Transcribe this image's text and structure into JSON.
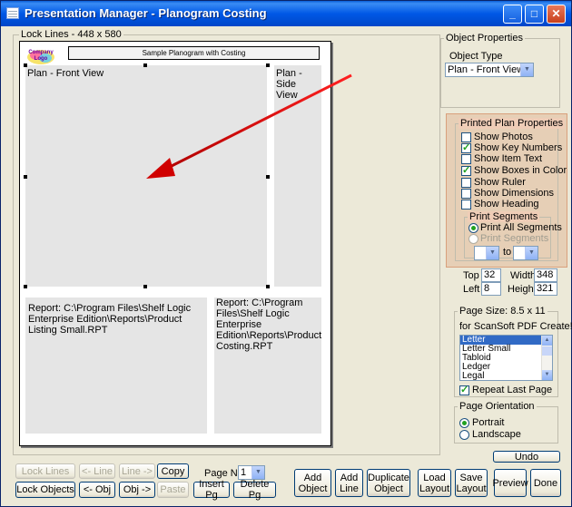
{
  "window": {
    "title": "Presentation Manager - Planogram Costing"
  },
  "canvas": {
    "legend": "Lock Lines - 448 x 580",
    "page": {
      "logo_text": "Company\nLogo",
      "banner": "Sample Planogram with Costing",
      "front_view_label": "Plan - Front View",
      "side_view_label": "Plan - Side View",
      "report1": "Report: C:\\Program Files\\Shelf Logic Enterprise Edition\\Reports\\Product Listing Small.RPT",
      "report2": "Report: C:\\Program Files\\Shelf Logic Enterprise Edition\\Reports\\Product Costing.RPT"
    }
  },
  "object_properties": {
    "legend": "Object Properties",
    "type_label": "Object Type",
    "type_value": "Plan - Front View"
  },
  "printed_plan_properties": {
    "legend": "Printed Plan Properties",
    "options": [
      {
        "label": "Show Photos",
        "checked": false
      },
      {
        "label": "Show Key Numbers",
        "checked": true
      },
      {
        "label": "Show Item Text",
        "checked": false
      },
      {
        "label": "Show Boxes in Color",
        "checked": true
      },
      {
        "label": "Show Ruler",
        "checked": false
      },
      {
        "label": "Show Dimensions",
        "checked": false
      },
      {
        "label": "Show Heading",
        "checked": false
      }
    ],
    "print_segments": {
      "legend": "Print Segments",
      "all_label": "Print All Segments",
      "some_label": "Print Segments",
      "to_label": "to"
    }
  },
  "position": {
    "top_label": "Top",
    "top_value": "32",
    "left_label": "Left",
    "left_value": "8",
    "width_label": "Width",
    "width_value": "348",
    "height_label": "Height",
    "height_value": "321"
  },
  "page_size": {
    "legend": "Page Size: 8.5 x 11",
    "pdf_note": "for ScanSoft PDF Create!",
    "sizes": [
      "Letter",
      "Letter Small",
      "Tabloid",
      "Ledger",
      "Legal"
    ],
    "selected": "Letter",
    "repeat_label": "Repeat Last Page"
  },
  "orientation": {
    "legend": "Page Orientation",
    "portrait": "Portrait",
    "landscape": "Landscape"
  },
  "buttons": {
    "lock_lines": "Lock Lines",
    "line_left": "<- Line",
    "line_right": "Line ->",
    "copy": "Copy",
    "lock_objects": "Lock Objects",
    "obj_left": "<- Obj",
    "obj_right": "Obj ->",
    "paste": "Paste",
    "page_nbr_label": "Page Nbr",
    "page_nbr_value": "1",
    "insert_pg": "Insert Pg",
    "delete_pg": "Delete Pg",
    "add_object": "Add\nObject",
    "add_line": "Add\nLine",
    "duplicate_object": "Duplicate\nObject",
    "load_layout": "Load\nLayout",
    "save_layout": "Save\nLayout",
    "preview": "Preview",
    "done": "Done",
    "undo": "Undo"
  }
}
